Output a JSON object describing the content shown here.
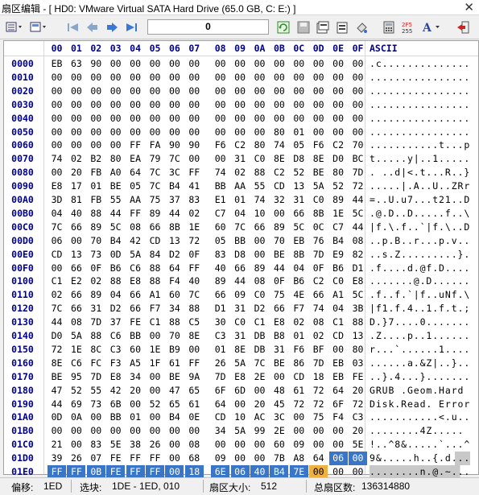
{
  "window": {
    "title": "扇区编辑 - [ HD0: VMware Virtual SATA Hard Drive (65.0 GB, C: E:) ]",
    "close_glyph": "✕"
  },
  "toolbar": {
    "offset_value": "0",
    "icons": [
      "view-mode-icon",
      "dropdown-icon",
      "first-sector-icon",
      "prev-sector-icon",
      "next-sector-icon",
      "last-sector-icon",
      "refresh-icon",
      "save-icon",
      "copy-icon",
      "paste-icon",
      "fill-icon",
      "calculator-icon",
      "checksum-icon",
      "font-icon",
      "exit-icon"
    ]
  },
  "hex": {
    "header_columns": [
      "00",
      "01",
      "02",
      "03",
      "04",
      "05",
      "06",
      "07",
      "08",
      "09",
      "0A",
      "0B",
      "0C",
      "0D",
      "0E",
      "0F"
    ],
    "ascii_header": "ASCII",
    "rows": [
      {
        "offset": "0000",
        "bytes": [
          "EB",
          "63",
          "90",
          "00",
          "00",
          "00",
          "00",
          "00",
          "00",
          "00",
          "00",
          "00",
          "00",
          "00",
          "00",
          "00"
        ],
        "ascii": ".c.............."
      },
      {
        "offset": "0010",
        "bytes": [
          "00",
          "00",
          "00",
          "00",
          "00",
          "00",
          "00",
          "00",
          "00",
          "00",
          "00",
          "00",
          "00",
          "00",
          "00",
          "00"
        ],
        "ascii": "................"
      },
      {
        "offset": "0020",
        "bytes": [
          "00",
          "00",
          "00",
          "00",
          "00",
          "00",
          "00",
          "00",
          "00",
          "00",
          "00",
          "00",
          "00",
          "00",
          "00",
          "00"
        ],
        "ascii": "................"
      },
      {
        "offset": "0030",
        "bytes": [
          "00",
          "00",
          "00",
          "00",
          "00",
          "00",
          "00",
          "00",
          "00",
          "00",
          "00",
          "00",
          "00",
          "00",
          "00",
          "00"
        ],
        "ascii": "................"
      },
      {
        "offset": "0040",
        "bytes": [
          "00",
          "00",
          "00",
          "00",
          "00",
          "00",
          "00",
          "00",
          "00",
          "00",
          "00",
          "00",
          "00",
          "00",
          "00",
          "00"
        ],
        "ascii": "................"
      },
      {
        "offset": "0050",
        "bytes": [
          "00",
          "00",
          "00",
          "00",
          "00",
          "00",
          "00",
          "00",
          "00",
          "00",
          "00",
          "80",
          "01",
          "00",
          "00",
          "00"
        ],
        "ascii": "................"
      },
      {
        "offset": "0060",
        "bytes": [
          "00",
          "00",
          "00",
          "00",
          "FF",
          "FA",
          "90",
          "90",
          "F6",
          "C2",
          "80",
          "74",
          "05",
          "F6",
          "C2",
          "70"
        ],
        "ascii": "...........t...p"
      },
      {
        "offset": "0070",
        "bytes": [
          "74",
          "02",
          "B2",
          "80",
          "EA",
          "79",
          "7C",
          "00",
          "00",
          "31",
          "C0",
          "8E",
          "D8",
          "8E",
          "D0",
          "BC"
        ],
        "ascii": "t.....y|..1....."
      },
      {
        "offset": "0080",
        "bytes": [
          "00",
          "20",
          "FB",
          "A0",
          "64",
          "7C",
          "3C",
          "FF",
          "74",
          "02",
          "88",
          "C2",
          "52",
          "BE",
          "80",
          "7D"
        ],
        "ascii": ". ..d|<.t...R..}"
      },
      {
        "offset": "0090",
        "bytes": [
          "E8",
          "17",
          "01",
          "BE",
          "05",
          "7C",
          "B4",
          "41",
          "BB",
          "AA",
          "55",
          "CD",
          "13",
          "5A",
          "52",
          "72"
        ],
        "ascii": ".....|.A..U..ZRr"
      },
      {
        "offset": "00A0",
        "bytes": [
          "3D",
          "81",
          "FB",
          "55",
          "AA",
          "75",
          "37",
          "83",
          "E1",
          "01",
          "74",
          "32",
          "31",
          "C0",
          "89",
          "44"
        ],
        "ascii": "=..U.u7...t21..D"
      },
      {
        "offset": "00B0",
        "bytes": [
          "04",
          "40",
          "88",
          "44",
          "FF",
          "89",
          "44",
          "02",
          "C7",
          "04",
          "10",
          "00",
          "66",
          "8B",
          "1E",
          "5C"
        ],
        "ascii": ".@.D..D.....f..\\"
      },
      {
        "offset": "00C0",
        "bytes": [
          "7C",
          "66",
          "89",
          "5C",
          "08",
          "66",
          "8B",
          "1E",
          "60",
          "7C",
          "66",
          "89",
          "5C",
          "0C",
          "C7",
          "44"
        ],
        "ascii": "|f.\\.f..`|f.\\..D"
      },
      {
        "offset": "00D0",
        "bytes": [
          "06",
          "00",
          "70",
          "B4",
          "42",
          "CD",
          "13",
          "72",
          "05",
          "BB",
          "00",
          "70",
          "EB",
          "76",
          "B4",
          "08"
        ],
        "ascii": "..p.B..r...p.v.."
      },
      {
        "offset": "00E0",
        "bytes": [
          "CD",
          "13",
          "73",
          "0D",
          "5A",
          "84",
          "D2",
          "0F",
          "83",
          "D8",
          "00",
          "BE",
          "8B",
          "7D",
          "E9",
          "82"
        ],
        "ascii": "..s.Z.........}."
      },
      {
        "offset": "00F0",
        "bytes": [
          "00",
          "66",
          "0F",
          "B6",
          "C6",
          "88",
          "64",
          "FF",
          "40",
          "66",
          "89",
          "44",
          "04",
          "0F",
          "B6",
          "D1"
        ],
        "ascii": ".f....d.@f.D...."
      },
      {
        "offset": "0100",
        "bytes": [
          "C1",
          "E2",
          "02",
          "88",
          "E8",
          "88",
          "F4",
          "40",
          "89",
          "44",
          "08",
          "0F",
          "B6",
          "C2",
          "C0",
          "E8"
        ],
        "ascii": ".......@.D......"
      },
      {
        "offset": "0110",
        "bytes": [
          "02",
          "66",
          "89",
          "04",
          "66",
          "A1",
          "60",
          "7C",
          "66",
          "09",
          "C0",
          "75",
          "4E",
          "66",
          "A1",
          "5C"
        ],
        "ascii": ".f..f.`|f..uNf.\\"
      },
      {
        "offset": "0120",
        "bytes": [
          "7C",
          "66",
          "31",
          "D2",
          "66",
          "F7",
          "34",
          "88",
          "D1",
          "31",
          "D2",
          "66",
          "F7",
          "74",
          "04",
          "3B"
        ],
        "ascii": "|f1.f.4..1.f.t.;"
      },
      {
        "offset": "0130",
        "bytes": [
          "44",
          "08",
          "7D",
          "37",
          "FE",
          "C1",
          "88",
          "C5",
          "30",
          "C0",
          "C1",
          "E8",
          "02",
          "08",
          "C1",
          "88"
        ],
        "ascii": "D.}7....0......."
      },
      {
        "offset": "0140",
        "bytes": [
          "D0",
          "5A",
          "88",
          "C6",
          "BB",
          "00",
          "70",
          "8E",
          "C3",
          "31",
          "DB",
          "B8",
          "01",
          "02",
          "CD",
          "13"
        ],
        "ascii": ".Z....p..1......"
      },
      {
        "offset": "0150",
        "bytes": [
          "72",
          "1E",
          "8C",
          "C3",
          "60",
          "1E",
          "B9",
          "00",
          "01",
          "8E",
          "DB",
          "31",
          "F6",
          "BF",
          "00",
          "80"
        ],
        "ascii": "r...`......1...."
      },
      {
        "offset": "0160",
        "bytes": [
          "8E",
          "C6",
          "FC",
          "F3",
          "A5",
          "1F",
          "61",
          "FF",
          "26",
          "5A",
          "7C",
          "BE",
          "86",
          "7D",
          "EB",
          "03"
        ],
        "ascii": "......a.&Z|..}.."
      },
      {
        "offset": "0170",
        "bytes": [
          "BE",
          "95",
          "7D",
          "E8",
          "34",
          "00",
          "BE",
          "9A",
          "7D",
          "E8",
          "2E",
          "00",
          "CD",
          "18",
          "EB",
          "FE"
        ],
        "ascii": "..}.4...}......."
      },
      {
        "offset": "0180",
        "bytes": [
          "47",
          "52",
          "55",
          "42",
          "20",
          "00",
          "47",
          "65",
          "6F",
          "6D",
          "00",
          "48",
          "61",
          "72",
          "64",
          "20"
        ],
        "ascii": "GRUB .Geom.Hard "
      },
      {
        "offset": "0190",
        "bytes": [
          "44",
          "69",
          "73",
          "6B",
          "00",
          "52",
          "65",
          "61",
          "64",
          "00",
          "20",
          "45",
          "72",
          "72",
          "6F",
          "72"
        ],
        "ascii": "Disk.Read. Error"
      },
      {
        "offset": "01A0",
        "bytes": [
          "0D",
          "0A",
          "00",
          "BB",
          "01",
          "00",
          "B4",
          "0E",
          "CD",
          "10",
          "AC",
          "3C",
          "00",
          "75",
          "F4",
          "C3"
        ],
        "ascii": "...........<.u.."
      },
      {
        "offset": "01B0",
        "bytes": [
          "00",
          "00",
          "00",
          "00",
          "00",
          "00",
          "00",
          "00",
          "34",
          "5A",
          "99",
          "2E",
          "00",
          "00",
          "00",
          "20"
        ],
        "ascii": "........4Z..... "
      },
      {
        "offset": "01C0",
        "bytes": [
          "21",
          "00",
          "83",
          "5E",
          "38",
          "26",
          "00",
          "08",
          "00",
          "00",
          "00",
          "60",
          "09",
          "00",
          "00",
          "5E"
        ],
        "ascii": "!..^8&.....`...^"
      },
      {
        "offset": "01D0",
        "bytes": [
          "39",
          "26",
          "07",
          "FE",
          "FF",
          "FF",
          "00",
          "68",
          "09",
          "00",
          "00",
          "7B",
          "A8",
          "64",
          "06",
          "00",
          "FE"
        ],
        "ascii": "9&.....h..{.d..."
      },
      {
        "offset": "01E0",
        "bytes": [
          "FF",
          "FF",
          "0B",
          "FE",
          "FF",
          "FF",
          "00",
          "18",
          "6E",
          "06",
          "40",
          "B4",
          "7E",
          "00",
          "00",
          "00"
        ],
        "ascii": "........n.@.~..."
      },
      {
        "offset": "01F0",
        "bytes": [
          "00",
          "00",
          "00",
          "00",
          "00",
          "00",
          "00",
          "00",
          "00",
          "00",
          "00",
          "00",
          "00",
          "00",
          "55",
          "AA"
        ],
        "ascii": "..............U."
      }
    ]
  },
  "status": {
    "offset_label": "偏移:",
    "offset_value": "1ED",
    "selection_label": "选块:",
    "selection_value": "1DE - 1ED, 010",
    "sector_size_label": "扇区大小:",
    "sector_size_value": "512",
    "total_sectors_label": "总扇区数:",
    "total_sectors_value": "136314880"
  },
  "colors": {
    "header_text": "#00008b",
    "selection": "#3a76c8",
    "cursor": "#f0b040"
  }
}
